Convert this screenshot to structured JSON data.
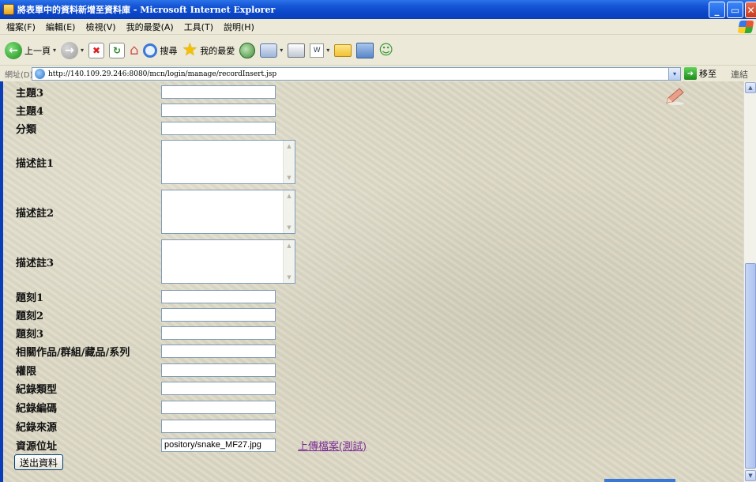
{
  "window": {
    "title": "將表單中的資料新增至資料庫 - Microsoft Internet Explorer",
    "buttons": {
      "minimize": "_",
      "maximize": "▭",
      "close": "✕"
    }
  },
  "menu": [
    "檔案(F)",
    "編輯(E)",
    "檢視(V)",
    "我的最愛(A)",
    "工具(T)",
    "說明(H)"
  ],
  "toolbar": {
    "back_label": "上一頁",
    "search_label": "搜尋",
    "favorites_label": "我的最愛",
    "dropdown_glyph": "▾"
  },
  "address": {
    "label": "網址(D)",
    "url": "http://140.109.29.246:8080/mcn/login/manage/recordInsert.jsp",
    "go_label": "移至",
    "links_label": "連結"
  },
  "form": {
    "fields": [
      {
        "label": "主題3",
        "type": "text",
        "value": ""
      },
      {
        "label": "主題4",
        "type": "text",
        "value": ""
      },
      {
        "label": "分類",
        "type": "text",
        "value": ""
      },
      {
        "label": "描述註1",
        "type": "textarea",
        "value": ""
      },
      {
        "label": "描述註2",
        "type": "textarea",
        "value": ""
      },
      {
        "label": "描述註3",
        "type": "textarea",
        "value": ""
      },
      {
        "label": "題刻1",
        "type": "text",
        "value": ""
      },
      {
        "label": "題刻2",
        "type": "text",
        "value": ""
      },
      {
        "label": "題刻3",
        "type": "text",
        "value": ""
      },
      {
        "label": "相關作品/群組/藏品/系列",
        "type": "text",
        "value": ""
      },
      {
        "label": "權限",
        "type": "text",
        "value": ""
      },
      {
        "label": "紀錄類型",
        "type": "text",
        "value": ""
      },
      {
        "label": "紀錄編碼",
        "type": "text",
        "value": ""
      },
      {
        "label": "紀錄來源",
        "type": "text",
        "value": ""
      },
      {
        "label": "資源位址",
        "type": "text",
        "value": "pository/snake_MF27.jpg"
      }
    ],
    "upload_link": "上傳檔案(測試)",
    "submit_label": "送出資料"
  },
  "colors": {
    "titlebar": "#0a46c8",
    "content_bg": "#ddd9c5",
    "link_visited": "#7a2b94",
    "input_border": "#7f9db9"
  }
}
